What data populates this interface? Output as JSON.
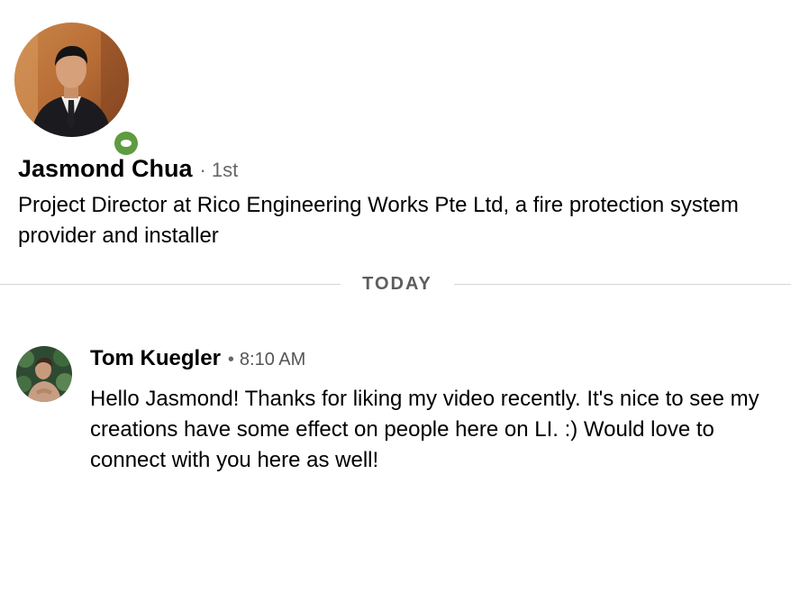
{
  "profile": {
    "name": "Jasmond Chua",
    "degree_separator": "·",
    "degree": "1st",
    "headline": "Project Director at Rico Engineering Works Pte Ltd, a fire protection system provider and installer",
    "presence": "online",
    "presence_color": "#5f9b41"
  },
  "divider": {
    "label": "TODAY"
  },
  "messages": [
    {
      "sender": "Tom Kuegler",
      "separator": "•",
      "time": "8:10 AM",
      "body": "Hello Jasmond! Thanks for liking my video recently. It's nice to see my creations have some effect on people here on LI. :) Would love to connect with you here as well!"
    }
  ]
}
